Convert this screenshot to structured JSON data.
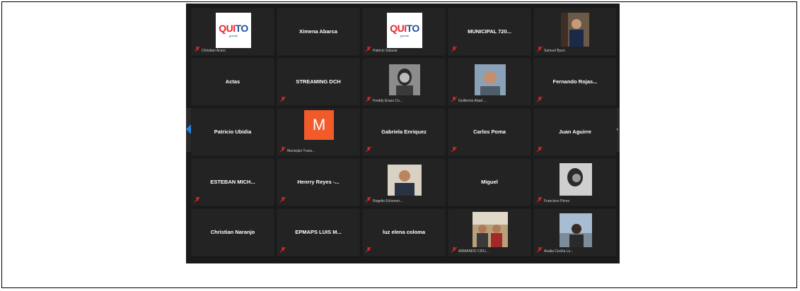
{
  "tiles": [
    {
      "name": "",
      "label": "Christian Acaro",
      "type": "quito"
    },
    {
      "name": "Ximena Abarca",
      "label": "",
      "type": "name"
    },
    {
      "name": "",
      "label": "Patricio Salazar",
      "type": "quito"
    },
    {
      "name": "MUNICIPAL 720...",
      "label": "",
      "type": "name"
    },
    {
      "name": "",
      "label": "Samuel Byun",
      "type": "photo"
    },
    {
      "name": "Actas",
      "label": "",
      "type": "name"
    },
    {
      "name": "STREAMING DCH",
      "label": "",
      "type": "name"
    },
    {
      "name": "",
      "label": "Freddy Erazo Co...",
      "type": "photo"
    },
    {
      "name": "",
      "label": "Guillermo Abad ...",
      "type": "photo"
    },
    {
      "name": "Fernando Rojas...",
      "label": "",
      "type": "name"
    },
    {
      "name": "Patricio Ubidia",
      "label": "",
      "type": "name"
    },
    {
      "name": "",
      "label": "Municipio Trans...",
      "type": "m"
    },
    {
      "name": "Gabriela Enriquez",
      "label": "",
      "type": "name"
    },
    {
      "name": "Carlos Poma",
      "label": "",
      "type": "name"
    },
    {
      "name": "Juan Aguirre",
      "label": "",
      "type": "name"
    },
    {
      "name": "ESTEBAN MICH...",
      "label": "",
      "type": "name"
    },
    {
      "name": "Henrry Reyes -...",
      "label": "",
      "type": "name"
    },
    {
      "name": "",
      "label": "Rogelio Echeverr...",
      "type": "photo"
    },
    {
      "name": "Miguel",
      "label": "",
      "type": "name"
    },
    {
      "name": "",
      "label": "Francisco Pérez",
      "type": "photo"
    },
    {
      "name": "Christian Naranjo",
      "label": "",
      "type": "name"
    },
    {
      "name": "EPMAPS LUIS M...",
      "label": "",
      "type": "name"
    },
    {
      "name": "luz elena coloma",
      "label": "",
      "type": "name"
    },
    {
      "name": "",
      "label": "ARMANDO CIFU...",
      "type": "photo"
    },
    {
      "name": "",
      "label": "Analia Cecilia Le...",
      "type": "photo"
    }
  ],
  "logos": {
    "quito_text_a": "QUI",
    "quito_text_b": "TO",
    "quito_tag": "grande",
    "m_letter": "M"
  },
  "colors": {
    "background": "#1a1a1a",
    "tile": "#232323",
    "mute_red": "#e02424",
    "m_orange": "#f15a29",
    "prev_arrow": "#1e88e5"
  }
}
